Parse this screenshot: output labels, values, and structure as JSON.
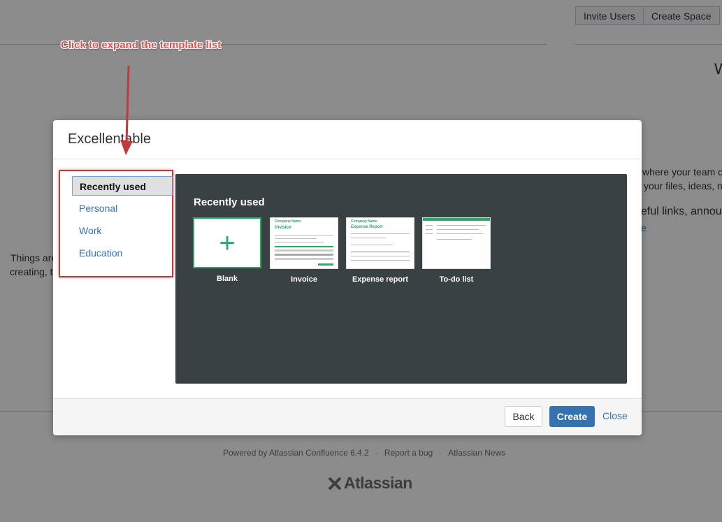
{
  "background": {
    "top_buttons": [
      "Invite Users",
      "Create Space"
    ],
    "heading_fragment": "W",
    "right_text": [
      "where your team c",
      "your files, ideas, n",
      "eful links, announ",
      "e"
    ],
    "left_text": [
      "Things are",
      "creating, t"
    ],
    "footer": {
      "links": [
        "Powered by Atlassian Confluence 6.4.2",
        "Report a bug",
        "Atlassian News"
      ],
      "separator": "·",
      "logo_text": "Atlassian"
    }
  },
  "annotation": {
    "text": "Click to expand the template list",
    "color": "#d9534f"
  },
  "dialog": {
    "title": "Excellentable",
    "sidebar": {
      "items": [
        {
          "label": "Recently used",
          "active": true
        },
        {
          "label": "Personal",
          "active": false
        },
        {
          "label": "Work",
          "active": false
        },
        {
          "label": "Education",
          "active": false
        }
      ]
    },
    "panel": {
      "title": "Recently used",
      "templates": [
        {
          "label": "Blank",
          "icon": "plus-icon"
        },
        {
          "label": "Invoice",
          "thumb_title": "Invoice",
          "thumb_header": "Company Name"
        },
        {
          "label": "Expense report",
          "thumb_title": "Expense Report",
          "thumb_header": "Company Name"
        },
        {
          "label": "To-do list"
        }
      ]
    },
    "footer": {
      "back_label": "Back",
      "create_label": "Create",
      "close_label": "Close"
    }
  },
  "colors": {
    "accent": "#3572b0",
    "panel_bg": "#3a4143",
    "template_green": "#2fa86a",
    "highlight_border": "#c0393b"
  }
}
